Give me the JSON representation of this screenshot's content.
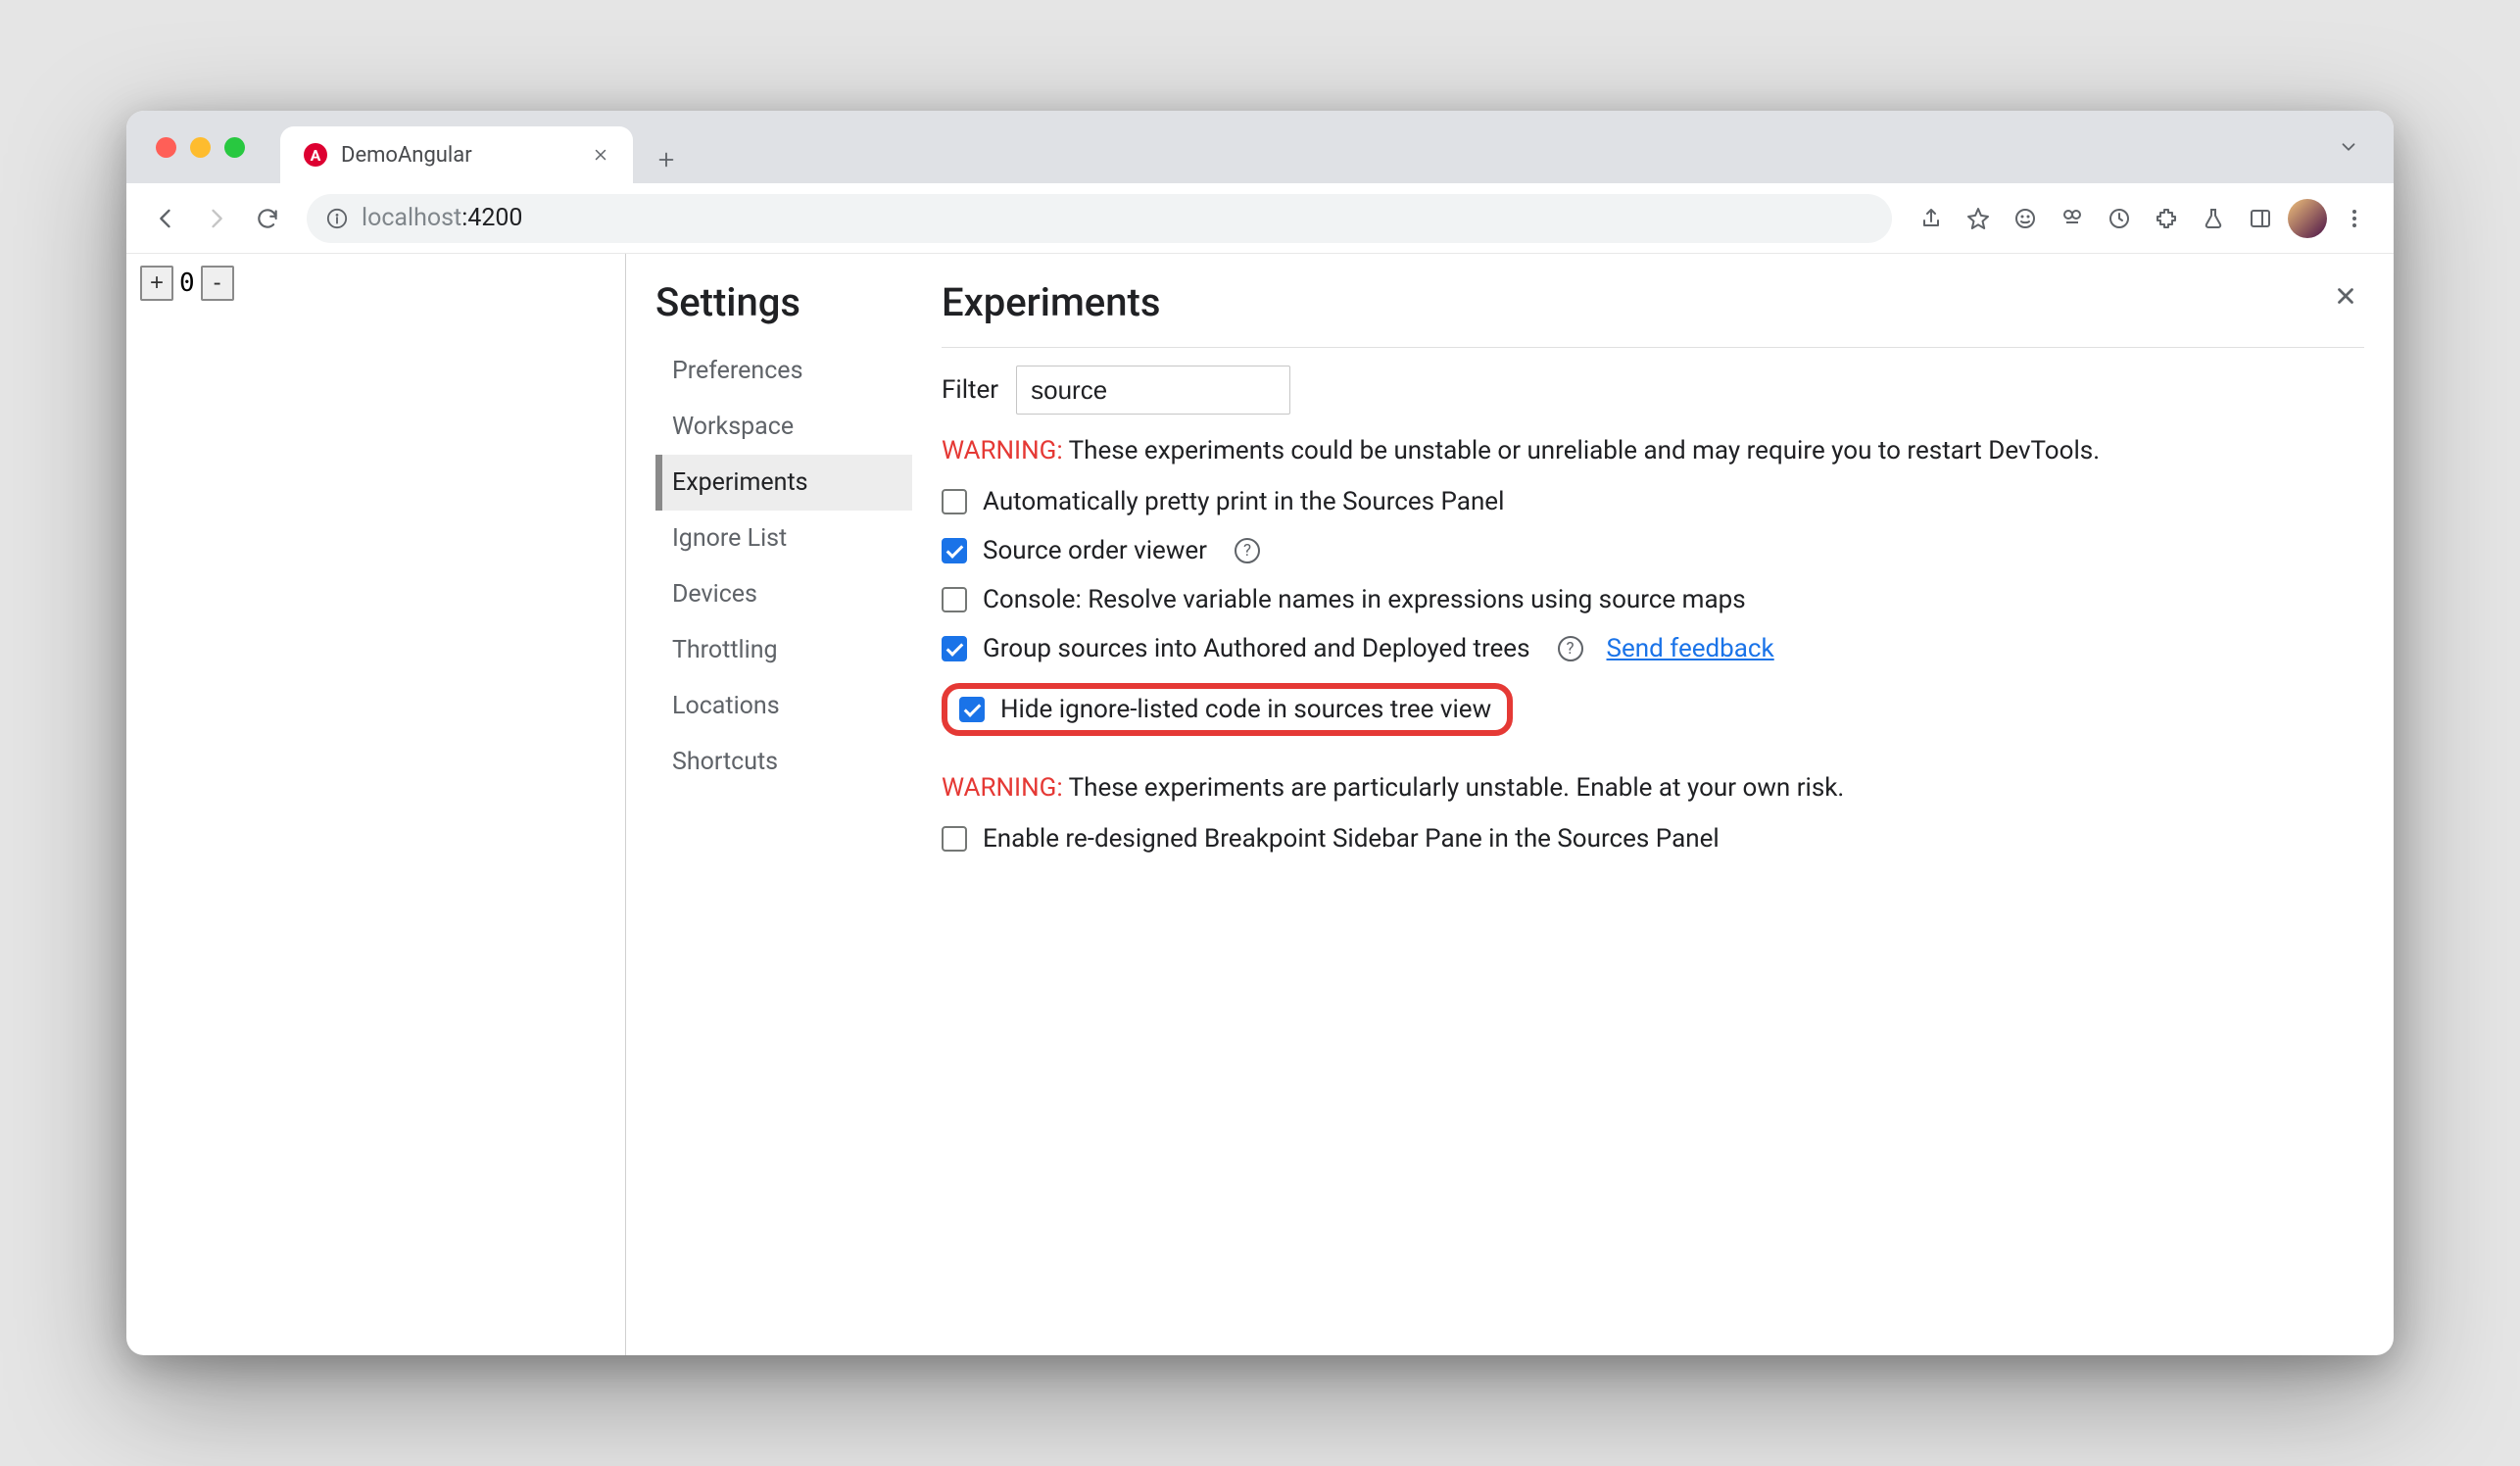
{
  "browser": {
    "tab": {
      "title": "DemoAngular",
      "favicon_label": "A"
    },
    "url": {
      "dim_prefix": "localhost",
      "port_suffix": ":4200"
    }
  },
  "page": {
    "counter": {
      "plus": "+",
      "value": "0",
      "minus": "-"
    }
  },
  "devtools": {
    "settings_title": "Settings",
    "close_label": "×",
    "sidebar": {
      "items": [
        {
          "label": "Preferences",
          "active": false
        },
        {
          "label": "Workspace",
          "active": false
        },
        {
          "label": "Experiments",
          "active": true
        },
        {
          "label": "Ignore List",
          "active": false
        },
        {
          "label": "Devices",
          "active": false
        },
        {
          "label": "Throttling",
          "active": false
        },
        {
          "label": "Locations",
          "active": false
        },
        {
          "label": "Shortcuts",
          "active": false
        }
      ]
    },
    "main": {
      "heading": "Experiments",
      "filter_label": "Filter",
      "filter_value": "source",
      "warning1": {
        "label": "WARNING:",
        "text": " These experiments could be unstable or unreliable and may require you to restart DevTools."
      },
      "experiments": [
        {
          "checked": false,
          "label": "Automatically pretty print in the Sources Panel",
          "help": false,
          "link": null,
          "highlight": false
        },
        {
          "checked": true,
          "label": "Source order viewer",
          "help": true,
          "link": null,
          "highlight": false
        },
        {
          "checked": false,
          "label": "Console: Resolve variable names in expressions using source maps",
          "help": false,
          "link": null,
          "highlight": false
        },
        {
          "checked": true,
          "label": "Group sources into Authored and Deployed trees",
          "help": true,
          "link": "Send feedback",
          "highlight": false
        },
        {
          "checked": true,
          "label": "Hide ignore-listed code in sources tree view",
          "help": false,
          "link": null,
          "highlight": true
        }
      ],
      "warning2": {
        "label": "WARNING:",
        "text": " These experiments are particularly unstable. Enable at your own risk."
      },
      "experiments2": [
        {
          "checked": false,
          "label": "Enable re-designed Breakpoint Sidebar Pane in the Sources Panel",
          "help": false,
          "link": null,
          "highlight": false
        }
      ]
    }
  }
}
